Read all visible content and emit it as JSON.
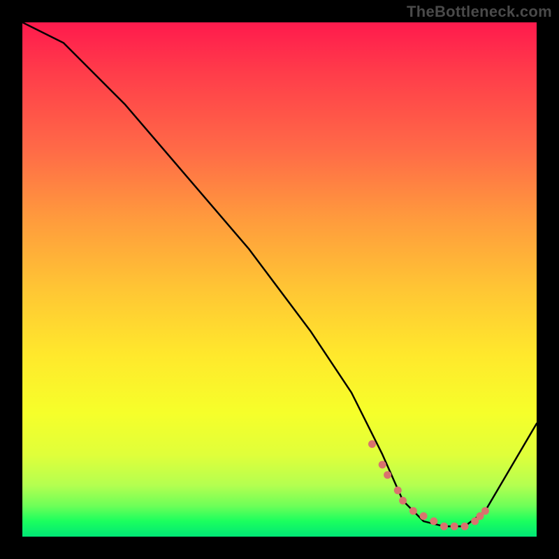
{
  "watermark": "TheBottleneck.com",
  "chart_data": {
    "type": "line",
    "title": "",
    "xlabel": "",
    "ylabel": "",
    "xlim": [
      0,
      100
    ],
    "ylim": [
      0,
      100
    ],
    "series": [
      {
        "name": "bottleneck-curve",
        "x": [
          0,
          8,
          20,
          32,
          44,
          56,
          64,
          70,
          74,
          78,
          82,
          86,
          90,
          100
        ],
        "values": [
          100,
          96,
          84,
          70,
          56,
          40,
          28,
          16,
          7,
          3,
          2,
          2,
          5,
          22
        ]
      }
    ],
    "markers": {
      "name": "optimal-range-dots",
      "color": "#d9736e",
      "x": [
        68,
        70,
        71,
        73,
        74,
        76,
        78,
        80,
        82,
        84,
        86,
        88,
        89,
        90
      ],
      "values": [
        18,
        14,
        12,
        9,
        7,
        5,
        4,
        3,
        2,
        2,
        2,
        3,
        4,
        5
      ]
    },
    "gradient_stops": [
      {
        "pos": 0,
        "color": "#ff1a4d"
      },
      {
        "pos": 25,
        "color": "#ff6b47"
      },
      {
        "pos": 52,
        "color": "#ffc634"
      },
      {
        "pos": 76,
        "color": "#f6ff2a"
      },
      {
        "pos": 100,
        "color": "#00e676"
      }
    ]
  }
}
